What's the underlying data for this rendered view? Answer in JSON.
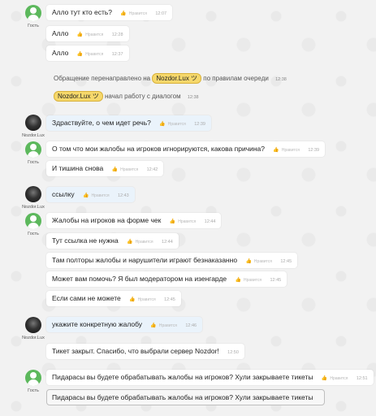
{
  "like_label": "Нравится",
  "guest_name": "Гость",
  "staff_name": "Nozdor.Lux",
  "messages": [
    {
      "text": "Алло тут кто есть?",
      "time": "12:07"
    },
    {
      "text": "Алло",
      "time": "12:28"
    },
    {
      "text": "Алло",
      "time": "12:37"
    },
    {
      "text": "Здраствуйте, о чем идет речь?",
      "time": "12:39"
    },
    {
      "text": "О том что мои жалобы на игроков игнорируются, какова причина?",
      "time": "12:39"
    },
    {
      "text": "И тишина снова",
      "time": "12:42"
    },
    {
      "text": "ссылку",
      "time": "12:43"
    },
    {
      "text": "Жалобы на игроков на форме чек",
      "time": "12:44"
    },
    {
      "text": "Тут ссылка не нужна",
      "time": "12:44"
    },
    {
      "text": "Там полторы жалобы и нарушители играют безнаказанно",
      "time": "12:45"
    },
    {
      "text": "Может вам помочь? Я был модератором на изенгарде",
      "time": "12:45"
    },
    {
      "text": "Если сами не можете",
      "time": "12:45"
    },
    {
      "text": "укажите конкретную жалобу",
      "time": "12:46"
    },
    {
      "text": "Пидарасы вы будете обрабатывать жалобы на игроков? Хули закрываете тикеты",
      "time": "12:51"
    }
  ],
  "system": {
    "redirect_prefix": "Обращение перенаправлено на",
    "redirect_suffix": "по правилам очереди",
    "redirect_time": "12:38",
    "agent_tag": "Nozdor.Lux ツ",
    "start_suffix": "начал работу с диалогом",
    "start_time": "12:38",
    "closed_text": "Тикет закрыт. Спасибо, что выбрали сервер Nozdor!",
    "closed_time": "12:50"
  },
  "input": {
    "value": "Пидарасы вы будете обрабатывать жалобы на игроков? Хули закрываете тикеты"
  }
}
